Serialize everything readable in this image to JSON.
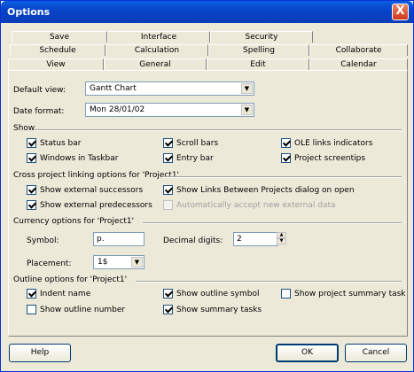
{
  "window": {
    "title": "Options",
    "close_glyph": "X"
  },
  "tabs": {
    "row1": [
      "Save",
      "Interface",
      "Security"
    ],
    "row2": [
      "Schedule",
      "Calculation",
      "Spelling",
      "Collaborate"
    ],
    "row3": [
      "View",
      "General",
      "Edit",
      "Calendar"
    ],
    "active": "View"
  },
  "default_view": {
    "label": "Default view:",
    "value": "Gantt Chart"
  },
  "date_format": {
    "label": "Date format:",
    "value": "Mon 28/01/02"
  },
  "show": {
    "title": "Show",
    "items": [
      {
        "label": "Status bar",
        "checked": true
      },
      {
        "label": "Scroll bars",
        "checked": true
      },
      {
        "label": "OLE links indicators",
        "checked": true
      },
      {
        "label": "Windows in Taskbar",
        "checked": true
      },
      {
        "label": "Entry bar",
        "checked": true
      },
      {
        "label": "Project screentips",
        "checked": true
      }
    ]
  },
  "cross_project": {
    "title": "Cross project linking options for 'Project1'",
    "items": [
      {
        "label": "Show external successors",
        "checked": true
      },
      {
        "label": "Show Links Between Projects dialog on open",
        "checked": true
      },
      {
        "label": "Show external predecessors",
        "checked": true
      },
      {
        "label": "Automatically accept new external data",
        "checked": false,
        "disabled": true
      }
    ]
  },
  "currency": {
    "title": "Currency options for 'Project1'",
    "symbol_label": "Symbol:",
    "symbol_value": "p.",
    "decimal_label": "Decimal digits:",
    "decimal_value": "2",
    "placement_label": "Placement:",
    "placement_value": "1$"
  },
  "outline": {
    "title": "Outline options for 'Project1'",
    "items": [
      {
        "label": "Indent name",
        "checked": true
      },
      {
        "label": "Show outline symbol",
        "checked": true
      },
      {
        "label": "Show project summary task",
        "checked": false
      },
      {
        "label": "Show outline number",
        "checked": false
      },
      {
        "label": "Show summary tasks",
        "checked": true
      }
    ]
  },
  "buttons": {
    "help": "Help",
    "ok": "OK",
    "cancel": "Cancel"
  },
  "icons": {
    "checkmark": "checkmark-icon",
    "dropdown": "chevron-down-icon",
    "spin_up": "spin-up-icon",
    "spin_down": "spin-down-icon"
  }
}
